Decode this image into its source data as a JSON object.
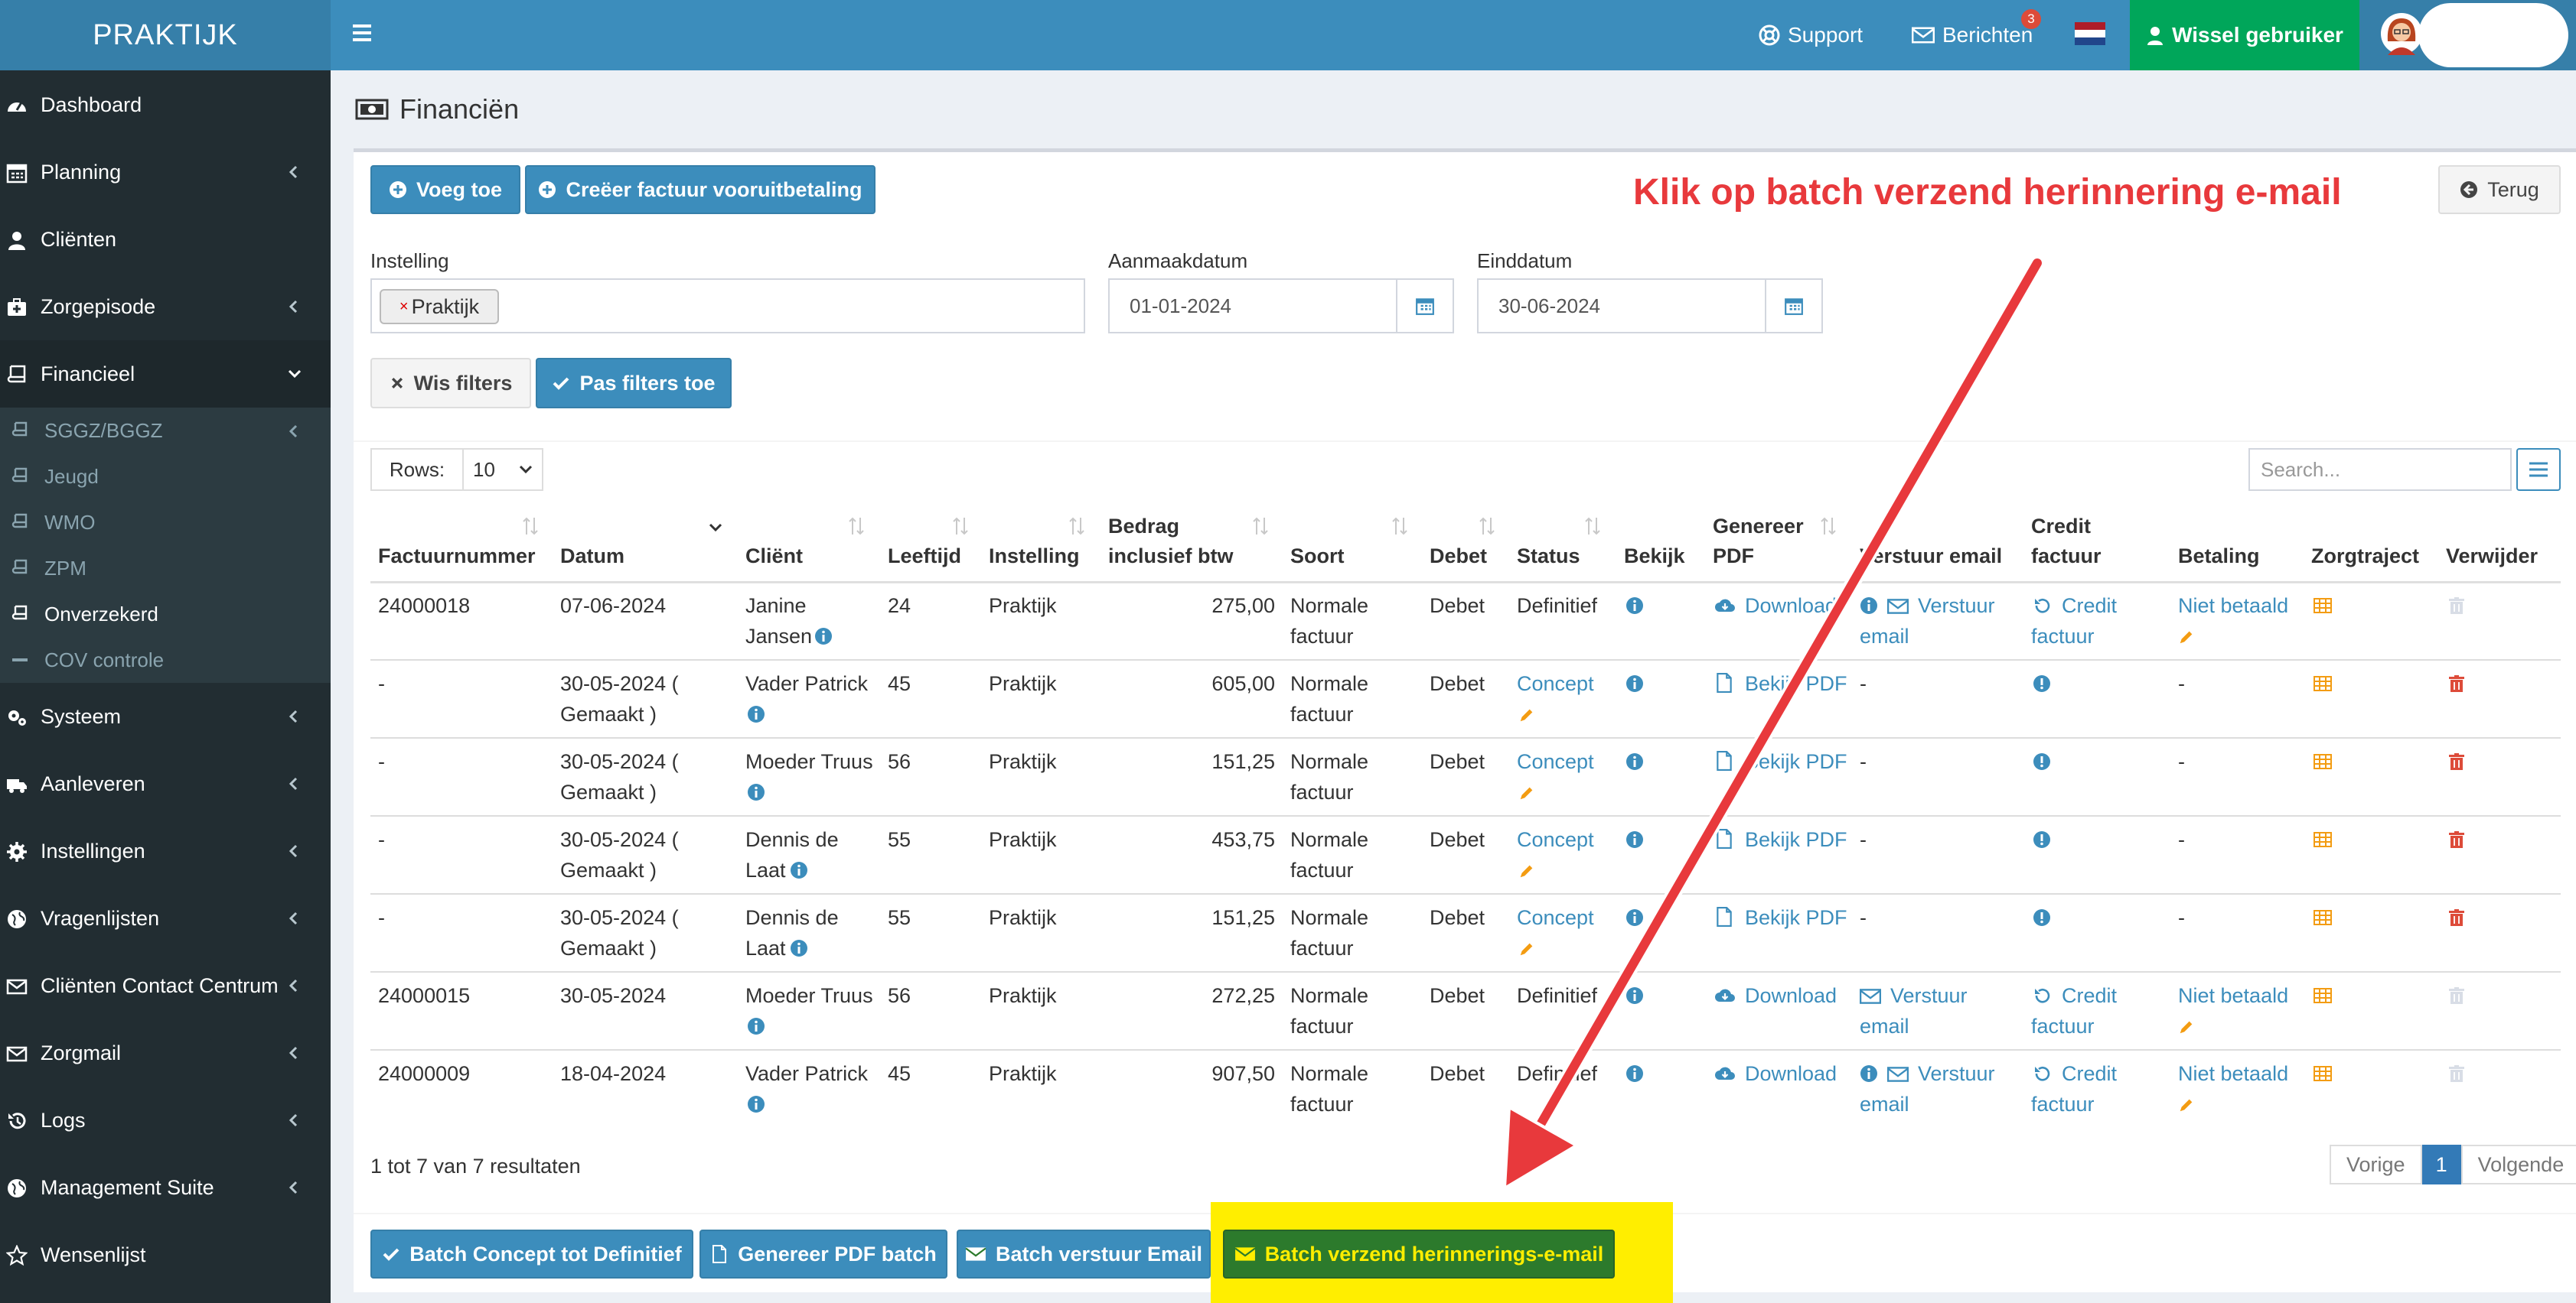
{
  "brand": "PRAKTIJK",
  "topnav": {
    "support": "Support",
    "berichten": "Berichten",
    "berichten_count": "3",
    "wissel": "Wissel gebruiker"
  },
  "sidebar": {
    "items": [
      {
        "label": "Dashboard",
        "icon": "dashboard-icon"
      },
      {
        "label": "Planning",
        "icon": "calendar-icon"
      },
      {
        "label": "Cliënten",
        "icon": "user-icon"
      },
      {
        "label": "Zorgepisode",
        "icon": "medkit-icon"
      },
      {
        "label": "Financieel",
        "icon": "book-icon"
      },
      {
        "label": "Systeem",
        "icon": "gears-icon"
      },
      {
        "label": "Aanleveren",
        "icon": "truck-icon"
      },
      {
        "label": "Instellingen",
        "icon": "gear-icon"
      },
      {
        "label": "Vragenlijsten",
        "icon": "globe-icon"
      },
      {
        "label": "Cliënten Contact Centrum",
        "icon": "envelope-icon"
      },
      {
        "label": "Zorgmail",
        "icon": "envelope-icon"
      },
      {
        "label": "Logs",
        "icon": "history-icon"
      },
      {
        "label": "Management Suite",
        "icon": "globe-icon"
      },
      {
        "label": "Wensenlijst",
        "icon": "star-icon"
      }
    ],
    "subitems": [
      {
        "label": "SGGZ/BGGZ"
      },
      {
        "label": "Jeugd"
      },
      {
        "label": "WMO"
      },
      {
        "label": "ZPM"
      },
      {
        "label": "Onverzekerd"
      },
      {
        "label": "COV controle"
      }
    ]
  },
  "page": {
    "title": "Financiën"
  },
  "toolbar": {
    "add": "Voeg toe",
    "create_invoice": "Creëer factuur vooruitbetaling",
    "back": "Terug"
  },
  "filters": {
    "instelling_label": "Instelling",
    "instelling_tag": "Praktijk",
    "aanmaak_label": "Aanmaakdatum",
    "aanmaak_value": "01-01-2024",
    "eind_label": "Einddatum",
    "eind_value": "30-06-2024",
    "clear": "Wis filters",
    "apply": "Pas filters toe"
  },
  "table": {
    "rows_label": "Rows:",
    "rows_value": "10",
    "search_placeholder": "Search...",
    "headers": [
      "Factuurnummer",
      "Datum",
      "Cliënt",
      "Leeftijd",
      "Instelling",
      "Bedrag inclusief btw",
      "Soort",
      "Debet",
      "Status",
      "Bekijk",
      "Genereer PDF",
      "Verstuur email",
      "Credit factuur",
      "Betaling",
      "Zorgtraject",
      "Verwijder"
    ],
    "rows": [
      {
        "nr": "24000018",
        "datum": "07-06-2024",
        "client": "Janine Jansen",
        "leeftijd": "24",
        "instelling": "Praktijk",
        "bedrag": "275,00",
        "soort": "Normale factuur",
        "debet": "Debet",
        "status": "Definitief",
        "pdf": "Download",
        "email": "Verstuur email",
        "credit": "Credit factuur",
        "betaling": "Niet betaald"
      },
      {
        "nr": "-",
        "datum": "30-05-2024 ( Gemaakt )",
        "client": "Vader Patrick",
        "leeftijd": "45",
        "instelling": "Praktijk",
        "bedrag": "605,00",
        "soort": "Normale factuur",
        "debet": "Debet",
        "status": "Concept",
        "pdf": "Bekijk PDF",
        "email": "-",
        "credit": "",
        "betaling": "-"
      },
      {
        "nr": "-",
        "datum": "30-05-2024 ( Gemaakt )",
        "client": "Moeder Truus",
        "leeftijd": "56",
        "instelling": "Praktijk",
        "bedrag": "151,25",
        "soort": "Normale factuur",
        "debet": "Debet",
        "status": "Concept",
        "pdf": "Bekijk PDF",
        "email": "-",
        "credit": "",
        "betaling": "-"
      },
      {
        "nr": "-",
        "datum": "30-05-2024 ( Gemaakt )",
        "client": "Dennis de Laat",
        "leeftijd": "55",
        "instelling": "Praktijk",
        "bedrag": "453,75",
        "soort": "Normale factuur",
        "debet": "Debet",
        "status": "Concept",
        "pdf": "Bekijk PDF",
        "email": "-",
        "credit": "",
        "betaling": "-"
      },
      {
        "nr": "-",
        "datum": "30-05-2024 ( Gemaakt )",
        "client": "Dennis de Laat",
        "leeftijd": "55",
        "instelling": "Praktijk",
        "bedrag": "151,25",
        "soort": "Normale factuur",
        "debet": "Debet",
        "status": "Concept",
        "pdf": "Bekijk PDF",
        "email": "-",
        "credit": "",
        "betaling": "-"
      },
      {
        "nr": "24000015",
        "datum": "30-05-2024",
        "client": "Moeder Truus",
        "leeftijd": "56",
        "instelling": "Praktijk",
        "bedrag": "272,25",
        "soort": "Normale factuur",
        "debet": "Debet",
        "status": "Definitief",
        "pdf": "Download",
        "email": "Verstuur email",
        "credit": "Credit factuur",
        "betaling": "Niet betaald"
      },
      {
        "nr": "24000009",
        "datum": "18-04-2024",
        "client": "Vader Patrick",
        "leeftijd": "45",
        "instelling": "Praktijk",
        "bedrag": "907,50",
        "soort": "Normale factuur",
        "debet": "Debet",
        "status": "Definitief",
        "pdf": "Download",
        "email": "Verstuur email",
        "credit": "Credit factuur",
        "betaling": "Niet betaald"
      }
    ]
  },
  "pagination": {
    "info": "1 tot 7 van 7 resultaten",
    "prev": "Vorige",
    "current": "1",
    "next": "Volgende"
  },
  "batch": {
    "concept": "Batch Concept tot Definitief",
    "pdf": "Genereer PDF batch",
    "email": "Batch verstuur Email",
    "reminder": "Batch verzend herinnerings-e-mail"
  },
  "annotation": {
    "text": "Klik op batch verzend herinnering e-mail",
    "color": "#e8393c",
    "highlight": "#ffee00"
  },
  "colors": {
    "primary": "#3c8dbc",
    "success": "#00a65a",
    "sidebar": "#222d32",
    "danger": "#dd4b39",
    "warning": "#f39c12"
  }
}
